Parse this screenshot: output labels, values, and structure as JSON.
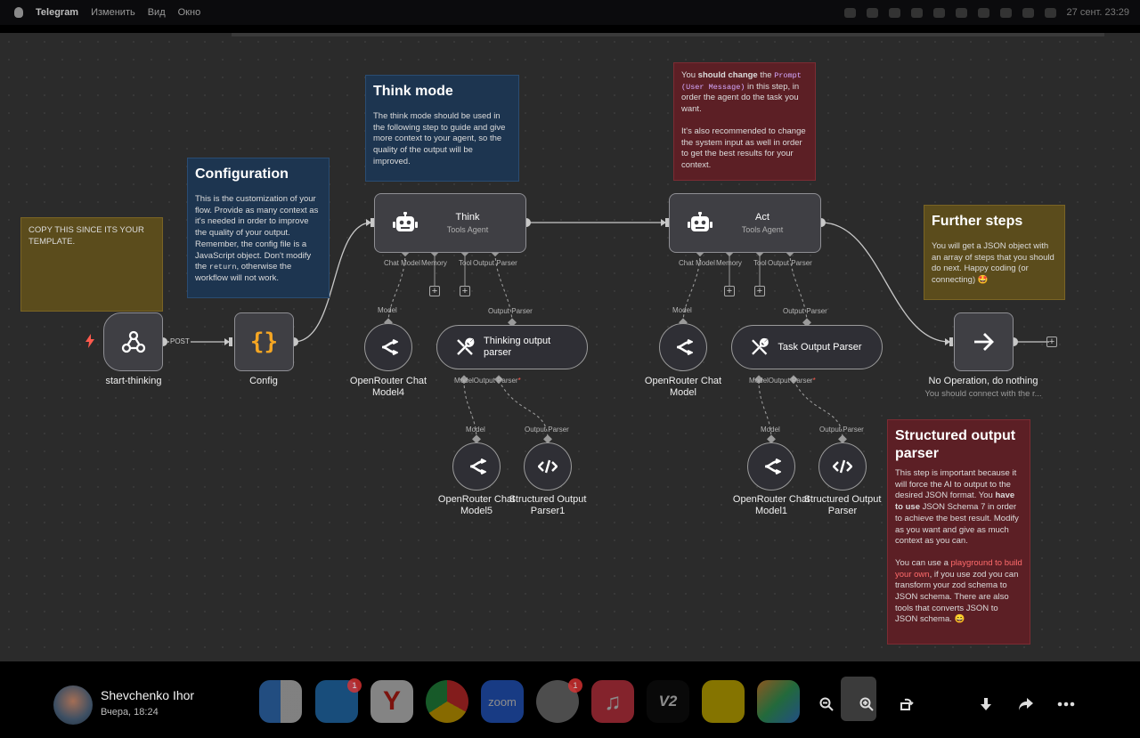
{
  "menubar": {
    "app_name": "Telegram",
    "items": [
      "Изменить",
      "Вид",
      "Окно"
    ],
    "clock": "27 сент. 23:29"
  },
  "notes": {
    "copy": "COPY THIS SINCE ITS YOUR TEMPLATE.",
    "configuration": {
      "title": "Configuration",
      "text_1": "This is the customization of your flow. Provide as many context as it's needed in order to improve the quality of your output. Remember, the config file is a JavaScript object. Don't modify the ",
      "code": "return",
      "text_2": ", otherwise the workflow will not work."
    },
    "think_mode": {
      "title": "Think mode",
      "text": "The think mode should be used in the following step to guide and give more context to your agent, so the quality of the output will be improved."
    },
    "act_note": {
      "t1": "You ",
      "bold1": "should change",
      "t2": " the ",
      "code": "Prompt (User Message)",
      "t3": " in this step, in order the agent do the task you want.",
      "t4": "It's also recommended to change the system input as well in order to get the best results for your context."
    },
    "further": {
      "title": "Further steps",
      "text": "You will get a JSON object with an array of steps that you should do next. Happy coding (or connecting) 🤩"
    },
    "structured": {
      "title": "Structured output parser",
      "t1": "This step is important because it will force the AI to output to the desired JSON format. You ",
      "bold": "have to use",
      "t2": " JSON Schema 7 in order to achieve the best result. Modify as you want and give as much context as you can.",
      "t3": "You can use a ",
      "link": "playground to build your own",
      "t4": ", if you use zod you can transform your zod schema to JSON schema. There are also tools that converts JSON to JSON schema. 😄"
    }
  },
  "nodes": {
    "start": {
      "label": "start-thinking",
      "edge_label": "POST",
      "icon": "webhook-icon"
    },
    "config": {
      "label": "Config",
      "icon": "curly-braces-icon"
    },
    "think": {
      "title": "Think",
      "subtitle": "Tools Agent",
      "icon": "robot-icon"
    },
    "act": {
      "title": "Act",
      "subtitle": "Tools Agent",
      "icon": "robot-icon"
    },
    "thinking_parser": {
      "label": "Thinking output parser",
      "icon": "wrench-icon"
    },
    "task_parser": {
      "label": "Task Output Parser",
      "icon": "wrench-icon"
    },
    "model4": {
      "label": "OpenRouter Chat Model4"
    },
    "model5": {
      "label": "OpenRouter Chat Model5"
    },
    "model_act": {
      "label": "OpenRouter Chat Model"
    },
    "model1": {
      "label": "OpenRouter Chat Model1"
    },
    "struct1": {
      "label": "Structured Output Parser1"
    },
    "struct": {
      "label": "Structured Output Parser"
    },
    "noop": {
      "label": "No Operation, do nothing",
      "sublabel": "You should connect with the r...",
      "icon": "arrow-right-icon"
    }
  },
  "ports": {
    "chat_model": "Chat Model",
    "memory": "Memory",
    "tool": "Tool",
    "output_parser": "Output Parser",
    "model": "Model",
    "model_star": "Model",
    "output_parser_star": "Output Parser",
    "required_mark": "*"
  },
  "dock": {
    "user_name": "Shevchenko Ihor",
    "timestamp": "Вчера, 18:24",
    "badge_telegram": "1",
    "badge_settings": "1",
    "zoom_label": "zoom",
    "v2_label": "V2"
  },
  "colors": {
    "canvas": "#2b2b2b",
    "note_yellow": "#5b4c1c",
    "note_blue": "#1d3550",
    "note_red": "#5c1f25",
    "trigger_red": "#ff5a4d",
    "config_orange": "#f5a623"
  }
}
